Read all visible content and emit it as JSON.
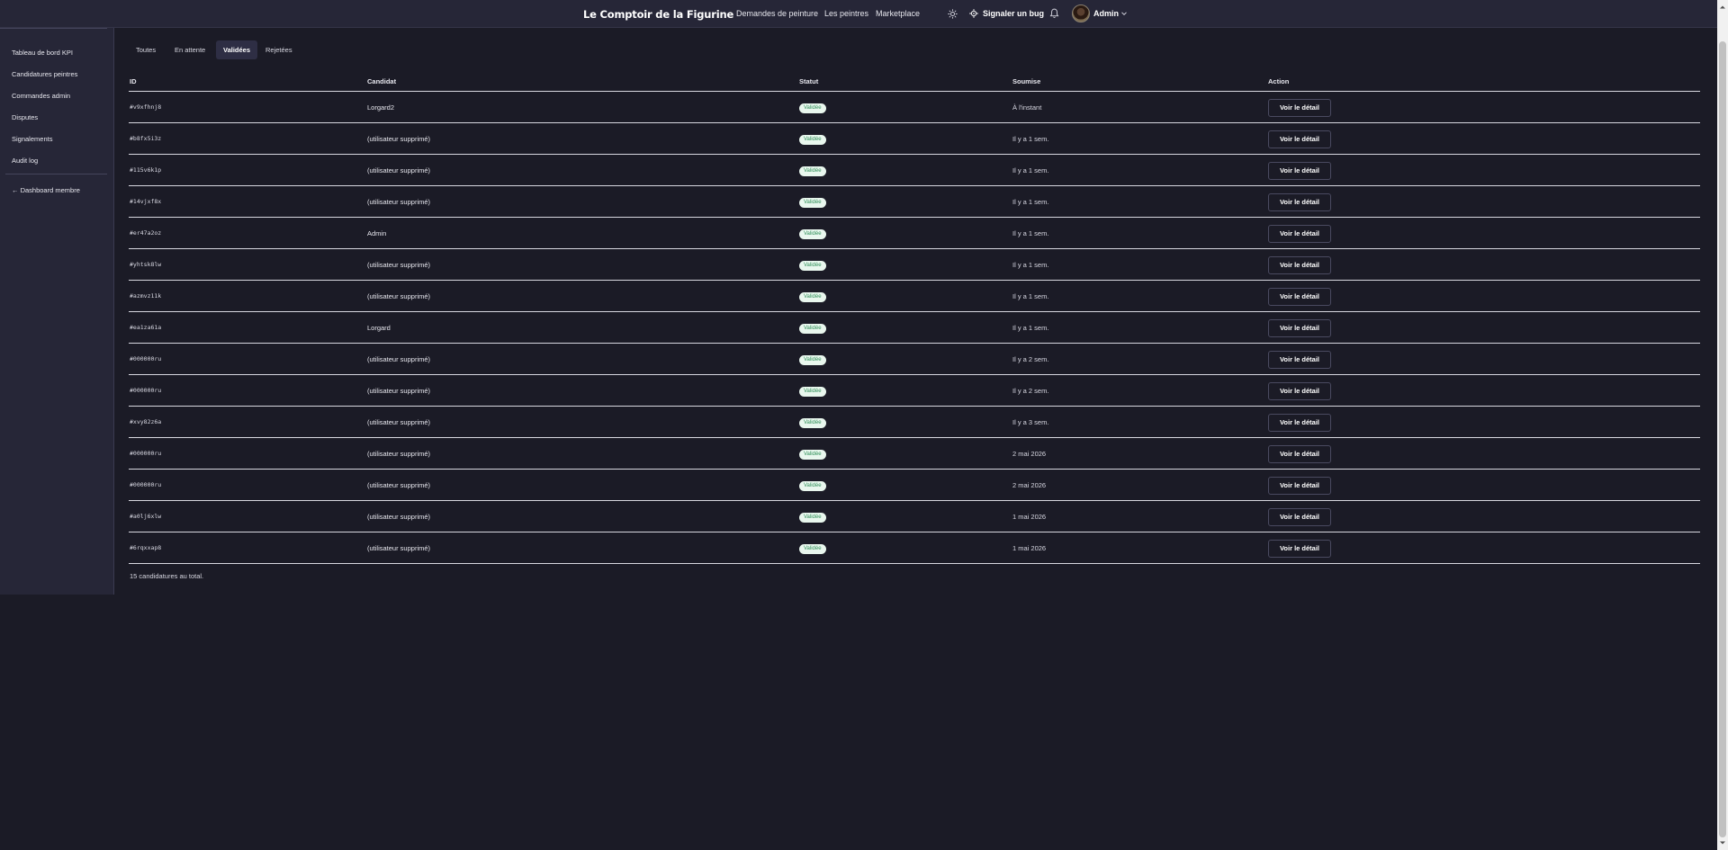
{
  "header": {
    "brand": "Le Comptoir de la Figurine",
    "nav": [
      "Demandes de peinture",
      "Les peintres",
      "Marketplace"
    ],
    "bug_label": "Signaler un bug",
    "user_label": "Admin"
  },
  "sidebar": {
    "items": [
      "Tableau de bord KPI",
      "Candidatures peintres",
      "Commandes admin",
      "Disputes",
      "Signalements",
      "Audit log"
    ],
    "back_link": "← Dashboard membre"
  },
  "tabs": {
    "items": [
      "Toutes",
      "En attente",
      "Validées",
      "Rejetées"
    ],
    "active": "Validées"
  },
  "table": {
    "headers": {
      "id": "ID",
      "candidat": "Candidat",
      "statut": "Statut",
      "soumise": "Soumise",
      "action": "Action"
    },
    "rows": [
      {
        "id": "#v9xfhnj8",
        "candidat": "Lorgard2",
        "statut": "Validée",
        "soumise": "À l'instant",
        "action": "Voir le détail"
      },
      {
        "id": "#b8fx5i3z",
        "candidat": "(utilisateur supprimé)",
        "statut": "Validée",
        "soumise": "Il y a 1 sem.",
        "action": "Voir le détail"
      },
      {
        "id": "#115v6k1p",
        "candidat": "(utilisateur supprimé)",
        "statut": "Validée",
        "soumise": "Il y a 1 sem.",
        "action": "Voir le détail"
      },
      {
        "id": "#14vjxf8x",
        "candidat": "(utilisateur supprimé)",
        "statut": "Validée",
        "soumise": "Il y a 1 sem.",
        "action": "Voir le détail"
      },
      {
        "id": "#er47a2oz",
        "candidat": "Admin",
        "statut": "Validée",
        "soumise": "Il y a 1 sem.",
        "action": "Voir le détail"
      },
      {
        "id": "#yhtsk8lw",
        "candidat": "(utilisateur supprimé)",
        "statut": "Validée",
        "soumise": "Il y a 1 sem.",
        "action": "Voir le détail"
      },
      {
        "id": "#azmvz11k",
        "candidat": "(utilisateur supprimé)",
        "statut": "Validée",
        "soumise": "Il y a 1 sem.",
        "action": "Voir le détail"
      },
      {
        "id": "#ea1za61a",
        "candidat": "Lorgard",
        "statut": "Validée",
        "soumise": "Il y a 1 sem.",
        "action": "Voir le détail"
      },
      {
        "id": "#000000ru",
        "candidat": "(utilisateur supprimé)",
        "statut": "Validée",
        "soumise": "Il y a 2 sem.",
        "action": "Voir le détail"
      },
      {
        "id": "#000000ru",
        "candidat": "(utilisateur supprimé)",
        "statut": "Validée",
        "soumise": "Il y a 2 sem.",
        "action": "Voir le détail"
      },
      {
        "id": "#xvy82z6a",
        "candidat": "(utilisateur supprimé)",
        "statut": "Validée",
        "soumise": "Il y a 3 sem.",
        "action": "Voir le détail"
      },
      {
        "id": "#000000ru",
        "candidat": "(utilisateur supprimé)",
        "statut": "Validée",
        "soumise": "2 mai 2026",
        "action": "Voir le détail"
      },
      {
        "id": "#000000ru",
        "candidat": "(utilisateur supprimé)",
        "statut": "Validée",
        "soumise": "2 mai 2026",
        "action": "Voir le détail"
      },
      {
        "id": "#a0lj6xlw",
        "candidat": "(utilisateur supprimé)",
        "statut": "Validée",
        "soumise": "1 mai 2026",
        "action": "Voir le détail"
      },
      {
        "id": "#6rqxxap8",
        "candidat": "(utilisateur supprimé)",
        "statut": "Validée",
        "soumise": "1 mai 2026",
        "action": "Voir le détail"
      }
    ],
    "total_text": "15 candidatures au total."
  },
  "colors": {
    "background": "#1b1b26",
    "panel": "#262637",
    "badge_bg": "#e9f7ee",
    "badge_text": "#2f8f58"
  }
}
